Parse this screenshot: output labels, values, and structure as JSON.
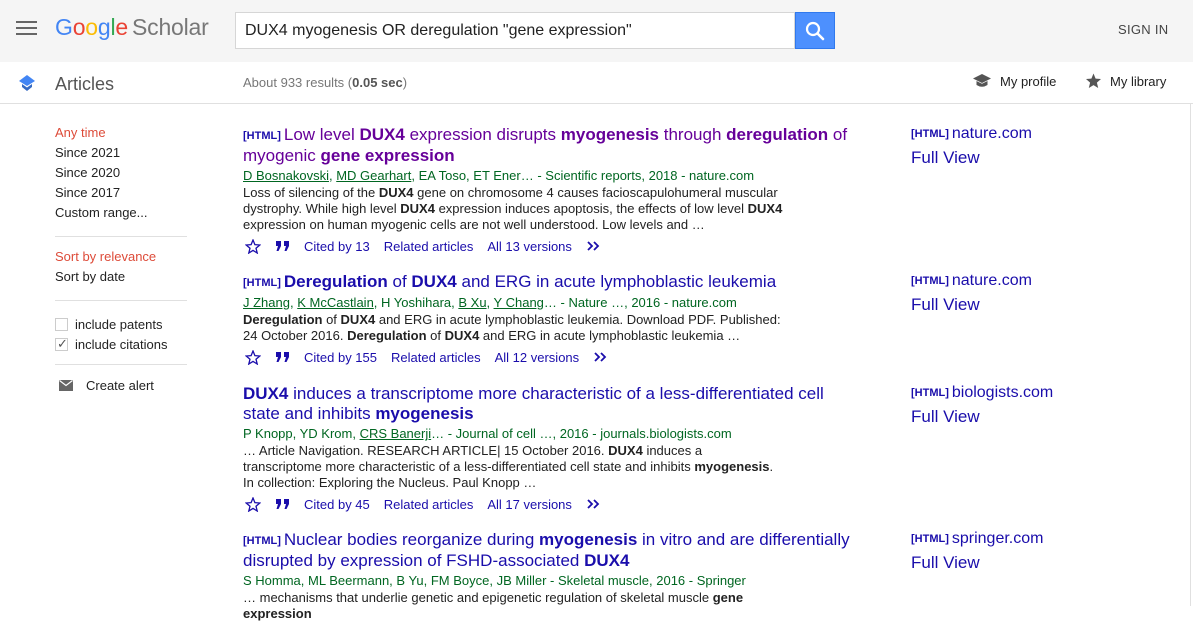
{
  "header": {
    "logo_google": "Google",
    "logo_scholar": "Scholar",
    "search_query": "DUX4 myogenesis OR deregulation \"gene expression\"",
    "sign_in": "SIGN IN"
  },
  "subbar": {
    "section": "Articles",
    "results_prefix": "About 933 results (",
    "results_time": "0.05 sec",
    "results_suffix": ")",
    "my_profile": "My profile",
    "my_library": "My library"
  },
  "sidebar": {
    "time_filters": [
      "Any time",
      "Since 2021",
      "Since 2020",
      "Since 2017",
      "Custom range..."
    ],
    "sort_options": [
      "Sort by relevance",
      "Sort by date"
    ],
    "include_patents": "include patents",
    "include_citations": "include citations",
    "create_alert": "Create alert"
  },
  "results": [
    {
      "tag": "[HTML]",
      "title_parts": [
        [
          "Low level ",
          false
        ],
        [
          "DUX4",
          true
        ],
        [
          " expression disrupts ",
          false
        ],
        [
          "myogenesis",
          true
        ],
        [
          " through ",
          false
        ],
        [
          "deregulation",
          true
        ],
        [
          " of myogenic ",
          false
        ],
        [
          "gene expression",
          true
        ]
      ],
      "authors_parts": [
        [
          "D Bosnakovski",
          true
        ],
        [
          ", ",
          false
        ],
        [
          "MD Gearhart",
          true
        ],
        [
          ", EA Toso, ET Ener… - Scientific reports, 2018 - nature.com",
          false
        ]
      ],
      "snippet_parts": [
        [
          "Loss of silencing of the ",
          false
        ],
        [
          "DUX4",
          true
        ],
        [
          " gene on chromosome 4 causes facioscapulohumeral muscular dystrophy. While high level ",
          false
        ],
        [
          "DUX4",
          true
        ],
        [
          " expression induces apoptosis, the effects of low level ",
          false
        ],
        [
          "DUX4",
          true
        ],
        [
          " expression on human myogenic cells are not well understood. Low levels and …",
          false
        ]
      ],
      "cited_by": "Cited by 13",
      "related": "Related articles",
      "versions": "All 13 versions",
      "side_tag": "[HTML]",
      "side_domain": "nature.com",
      "full_view": "Full View"
    },
    {
      "tag": "[HTML]",
      "title_parts": [
        [
          "Deregulation",
          true
        ],
        [
          " of ",
          false
        ],
        [
          "DUX4",
          true
        ],
        [
          " and ERG in acute lymphoblastic leukemia",
          false
        ]
      ],
      "authors_parts": [
        [
          "J Zhang",
          true
        ],
        [
          ", ",
          false
        ],
        [
          "K McCastlain",
          true
        ],
        [
          ", H Yoshihara, ",
          false
        ],
        [
          "B Xu",
          true
        ],
        [
          ", ",
          false
        ],
        [
          "Y Chang",
          true
        ],
        [
          "… - Nature …, 2016 - nature.com",
          false
        ]
      ],
      "snippet_parts": [
        [
          "Deregulation",
          true
        ],
        [
          " of ",
          false
        ],
        [
          "DUX4",
          true
        ],
        [
          " and ERG in acute lymphoblastic leukemia. Download PDF. Published: 24 October 2016. ",
          false
        ],
        [
          "Deregulation",
          true
        ],
        [
          " of ",
          false
        ],
        [
          "DUX4",
          true
        ],
        [
          " and ERG in acute lymphoblastic leukemia …",
          false
        ]
      ],
      "cited_by": "Cited by 155",
      "related": "Related articles",
      "versions": "All 12 versions",
      "side_tag": "[HTML]",
      "side_domain": "nature.com",
      "full_view": "Full View"
    },
    {
      "tag": "",
      "title_parts": [
        [
          "DUX4",
          true
        ],
        [
          " induces a transcriptome more characteristic of a less-differentiated cell state and inhibits ",
          false
        ],
        [
          "myogenesis",
          true
        ]
      ],
      "authors_parts": [
        [
          "P Knopp, YD Krom, ",
          false
        ],
        [
          "CRS Banerji",
          true
        ],
        [
          "… - Journal of cell …, 2016 - journals.biologists.com",
          false
        ]
      ],
      "snippet_parts": [
        [
          "… Article Navigation. RESEARCH ARTICLE| 15 October 2016. ",
          false
        ],
        [
          "DUX4",
          true
        ],
        [
          " induces a transcriptome more characteristic of a less-differentiated cell state and inhibits ",
          false
        ],
        [
          "myogenesis",
          true
        ],
        [
          ". In collection: Exploring the Nucleus. Paul Knopp …",
          false
        ]
      ],
      "cited_by": "Cited by 45",
      "related": "Related articles",
      "versions": "All 17 versions",
      "side_tag": "[HTML]",
      "side_domain": "biologists.com",
      "full_view": "Full View"
    },
    {
      "tag": "[HTML]",
      "title_parts": [
        [
          "Nuclear bodies reorganize during ",
          false
        ],
        [
          "myogenesis",
          true
        ],
        [
          " in vitro and are differentially disrupted by expression of FSHD-associated ",
          false
        ],
        [
          "DUX4",
          true
        ]
      ],
      "authors_parts": [
        [
          "S Homma, ML Beermann, B Yu, FM Boyce, JB Miller - Skeletal muscle, 2016 - Springer",
          false
        ]
      ],
      "snippet_parts": [
        [
          "… mechanisms that underlie genetic and epigenetic regulation of skeletal muscle ",
          false
        ],
        [
          "gene expression",
          true
        ]
      ],
      "cited_by": "",
      "related": "",
      "versions": "",
      "side_tag": "[HTML]",
      "side_domain": "springer.com",
      "full_view": "Full View"
    }
  ],
  "colors": {
    "link": "#1a0dab",
    "visited": "#660099",
    "authors": "#006621",
    "active_filter": "#dd4b39",
    "search_button": "#4d90fe"
  }
}
